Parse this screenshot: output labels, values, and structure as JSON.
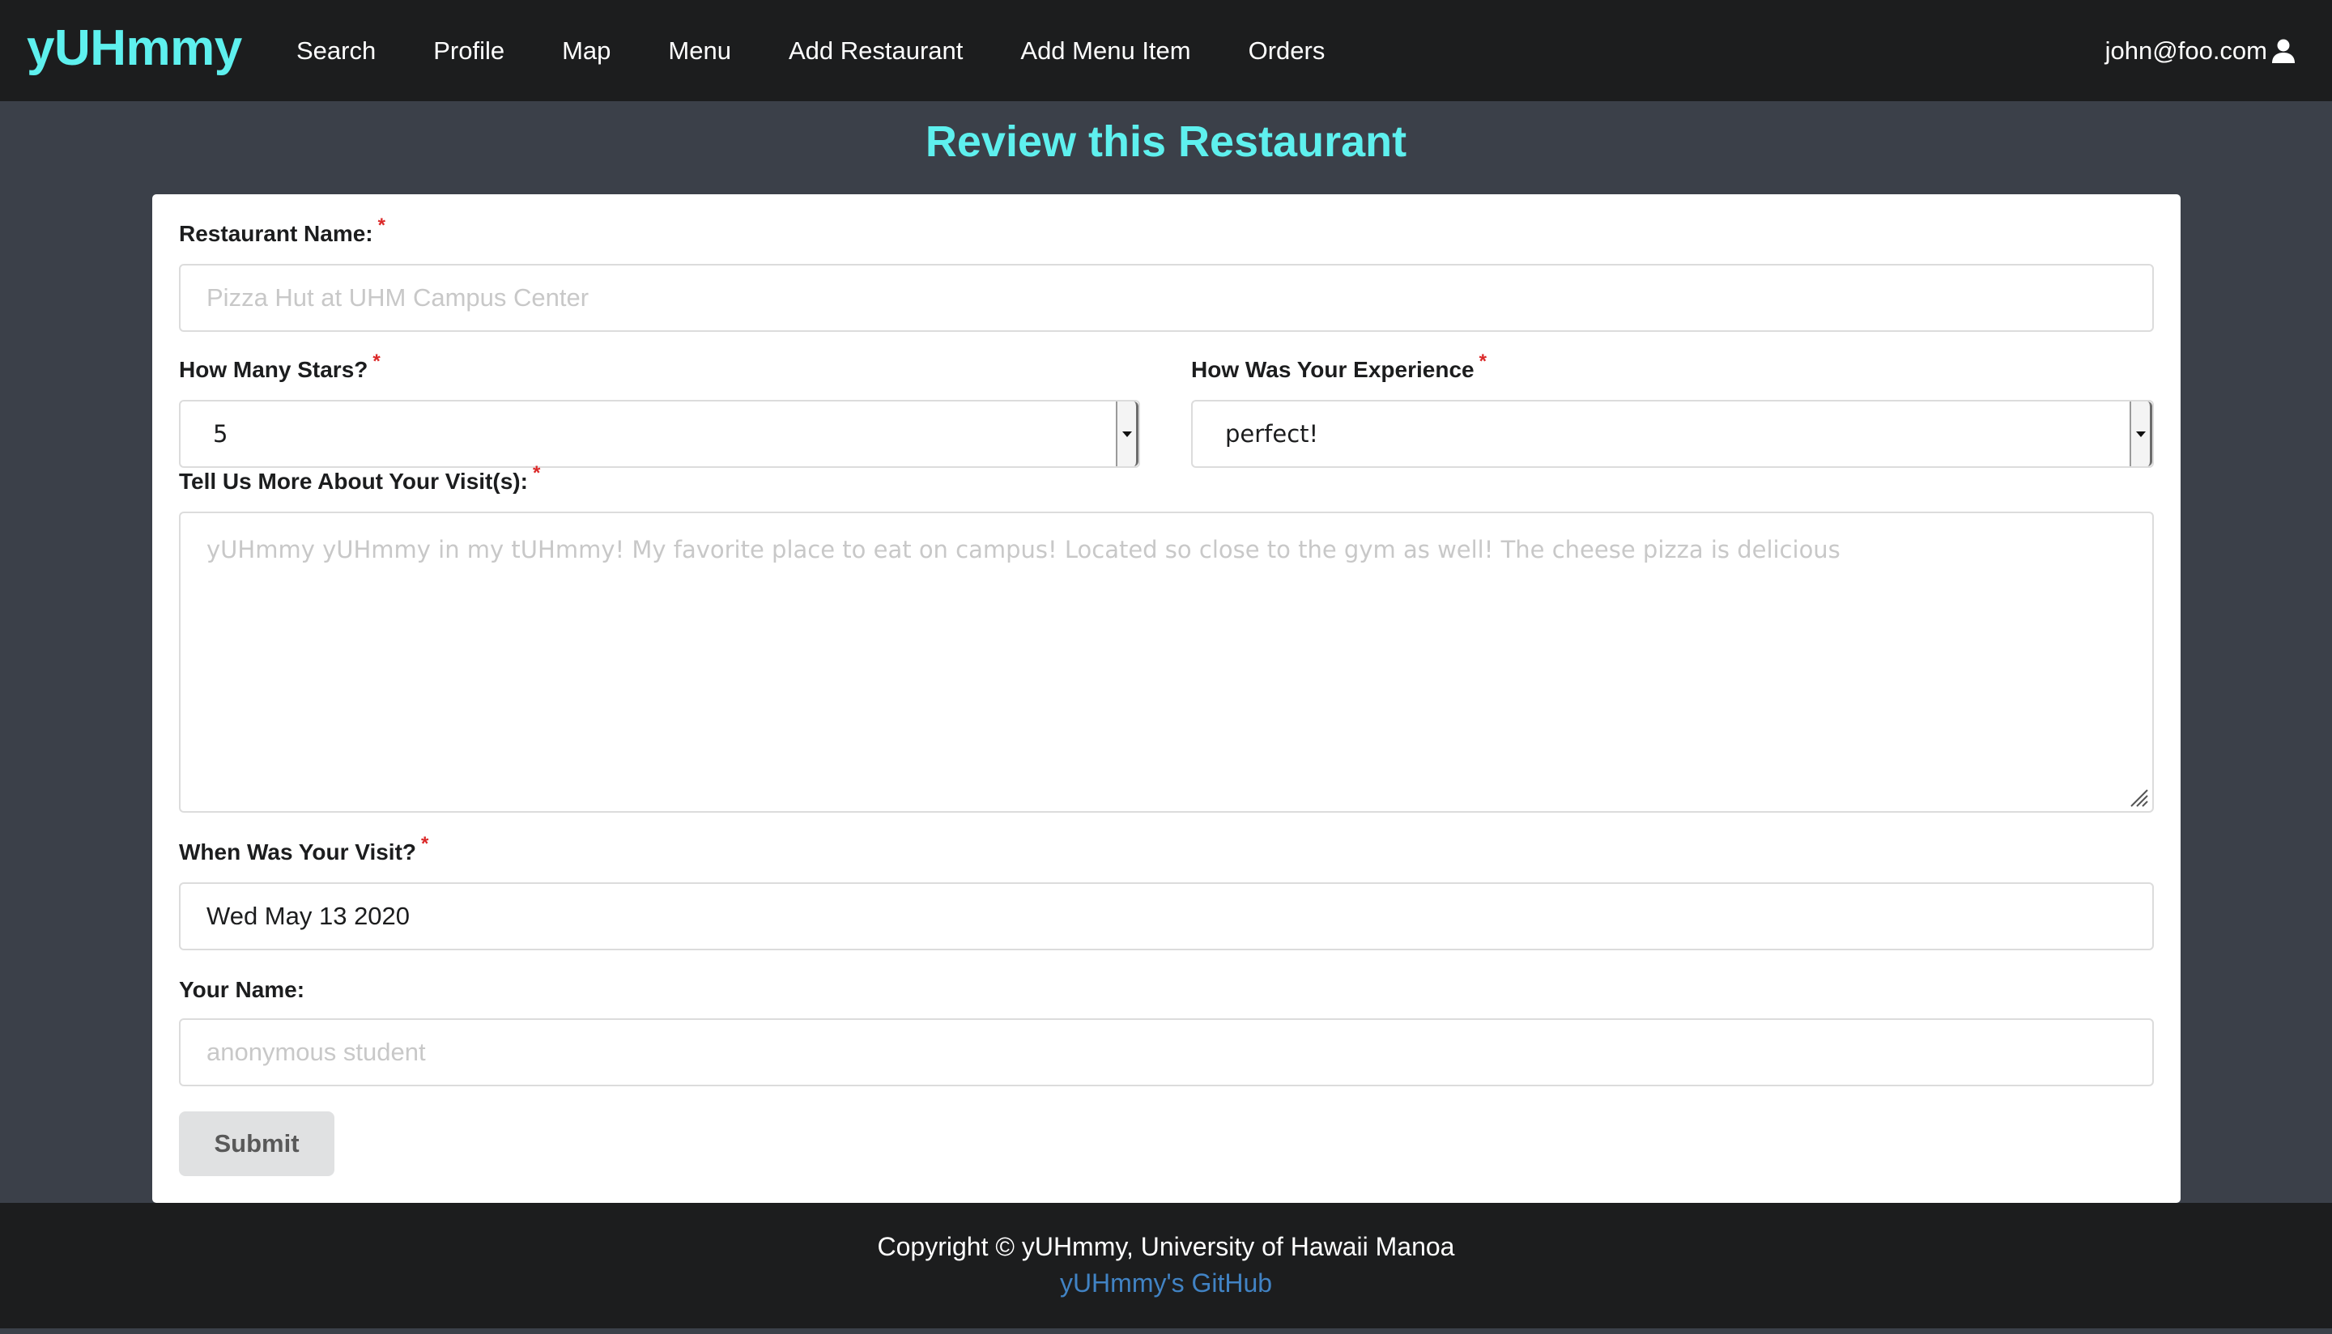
{
  "navbar": {
    "brand": "yUHmmy",
    "items": [
      {
        "label": "Search"
      },
      {
        "label": "Profile"
      },
      {
        "label": "Map"
      },
      {
        "label": "Menu"
      },
      {
        "label": "Add Restaurant"
      },
      {
        "label": "Add Menu Item"
      },
      {
        "label": "Orders"
      }
    ],
    "user": {
      "email": "john@foo.com",
      "icon": "user-icon"
    }
  },
  "page": {
    "title": "Review this Restaurant"
  },
  "form": {
    "restaurant_name": {
      "label": "Restaurant Name:",
      "required": "*",
      "placeholder": "Pizza Hut at UHM Campus Center"
    },
    "stars": {
      "label": "How Many Stars?",
      "required": "*",
      "value": "5"
    },
    "experience": {
      "label": "How Was Your Experience",
      "required": "*",
      "value": "perfect!"
    },
    "details": {
      "label": "Tell Us More About Your Visit(s):",
      "required": "*",
      "placeholder": "yUHmmy yUHmmy in my tUHmmy! My favorite place to eat on campus! Located so close to the gym as well! The cheese pizza is delicious"
    },
    "visit_date": {
      "label": "When Was Your Visit?",
      "required": "*",
      "value": "Wed May 13 2020"
    },
    "your_name": {
      "label": "Your Name:",
      "placeholder": "anonymous student"
    },
    "submit_label": "Submit"
  },
  "footer": {
    "copyright": "Copyright © yUHmmy, University of Hawaii Manoa",
    "github_link": "yUHmmy's GitHub"
  },
  "colors": {
    "brand": "#5ef0ee",
    "navbar_bg": "#1c1d1e",
    "page_bg": "#3b4049",
    "required": "#db2828",
    "link": "#4183c4"
  }
}
